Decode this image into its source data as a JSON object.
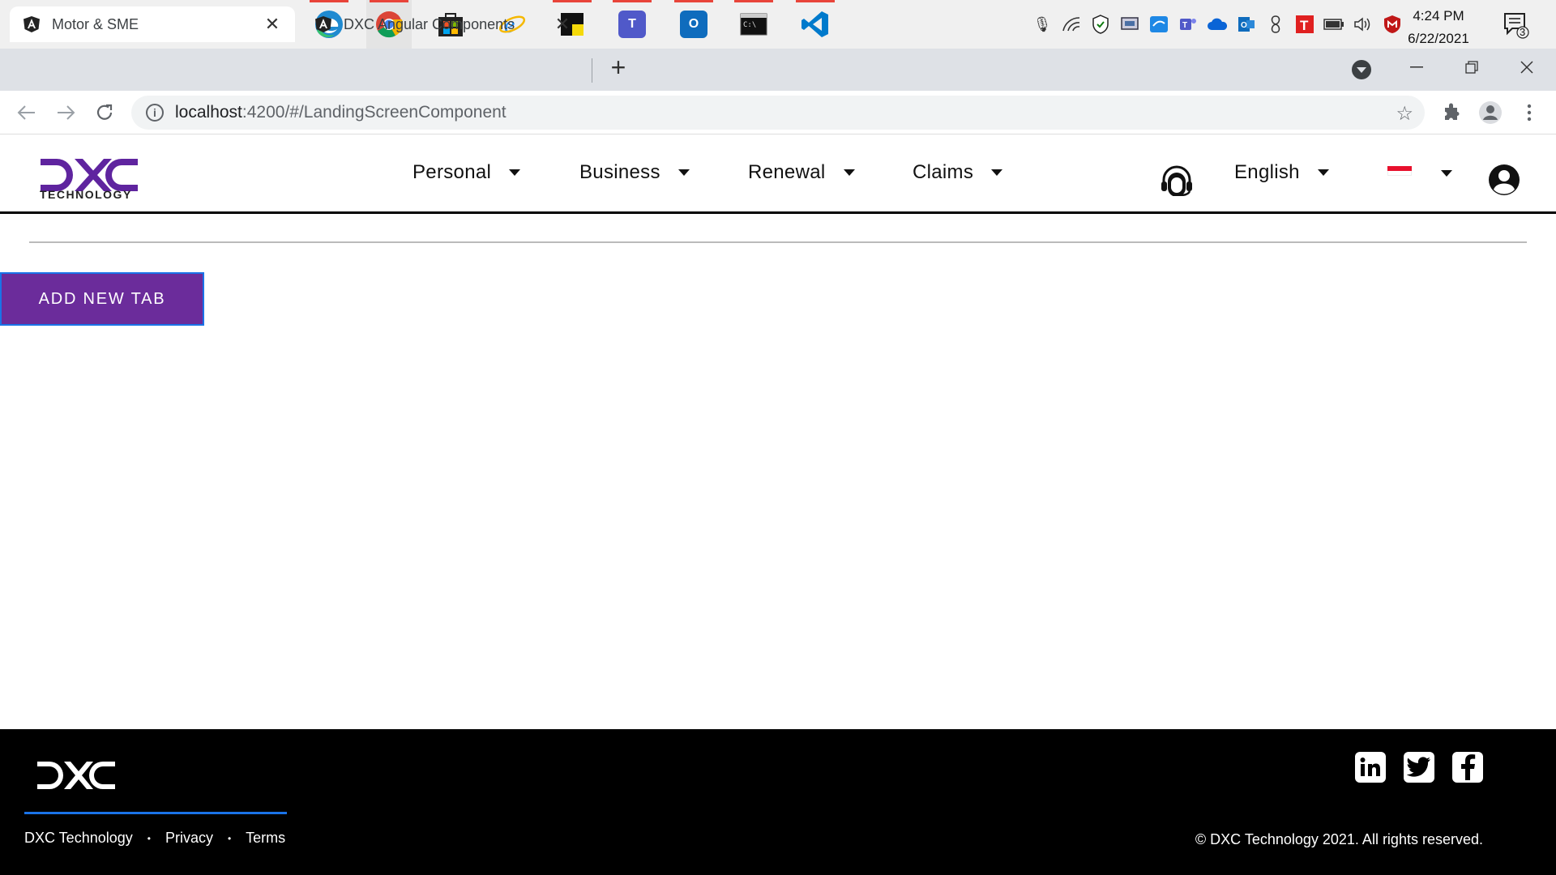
{
  "taskbar": {
    "apps": [
      {
        "name": "start-icon"
      },
      {
        "name": "search-icon"
      },
      {
        "name": "task-view-icon"
      },
      {
        "name": "file-explorer-icon"
      },
      {
        "name": "firefox-icon"
      },
      {
        "name": "edge-icon"
      },
      {
        "name": "chrome-icon"
      },
      {
        "name": "store-icon"
      },
      {
        "name": "internet-explorer-icon"
      },
      {
        "name": "sticky-notes-icon"
      },
      {
        "name": "teams-icon"
      },
      {
        "name": "outlook-icon"
      },
      {
        "name": "terminal-icon"
      },
      {
        "name": "vscode-icon"
      }
    ],
    "clock_time": "4:24 PM",
    "clock_date": "6/22/2021",
    "notification_count": "3"
  },
  "browser": {
    "tabs": [
      {
        "title": "Motor & SME"
      },
      {
        "title": "DXC Angular Components"
      }
    ],
    "new_tab_label": "+",
    "url_host": "localhost",
    "url_path": ":4200/#/LandingScreenComponent"
  },
  "header": {
    "logo_text": "TECHNOLOGY",
    "menu": [
      {
        "label": "Personal"
      },
      {
        "label": "Business"
      },
      {
        "label": "Renewal"
      },
      {
        "label": "Claims"
      }
    ],
    "language": "English"
  },
  "content": {
    "add_tab_label": "ADD NEW TAB"
  },
  "footer": {
    "links": [
      "DXC Technology",
      "Privacy",
      "Terms"
    ],
    "copyright": "© DXC Technology 2021. All rights reserved."
  },
  "colors": {
    "brand_purple": "#6b2c9b",
    "accent_blue": "#1a73e8",
    "footer_bg": "#000000"
  }
}
